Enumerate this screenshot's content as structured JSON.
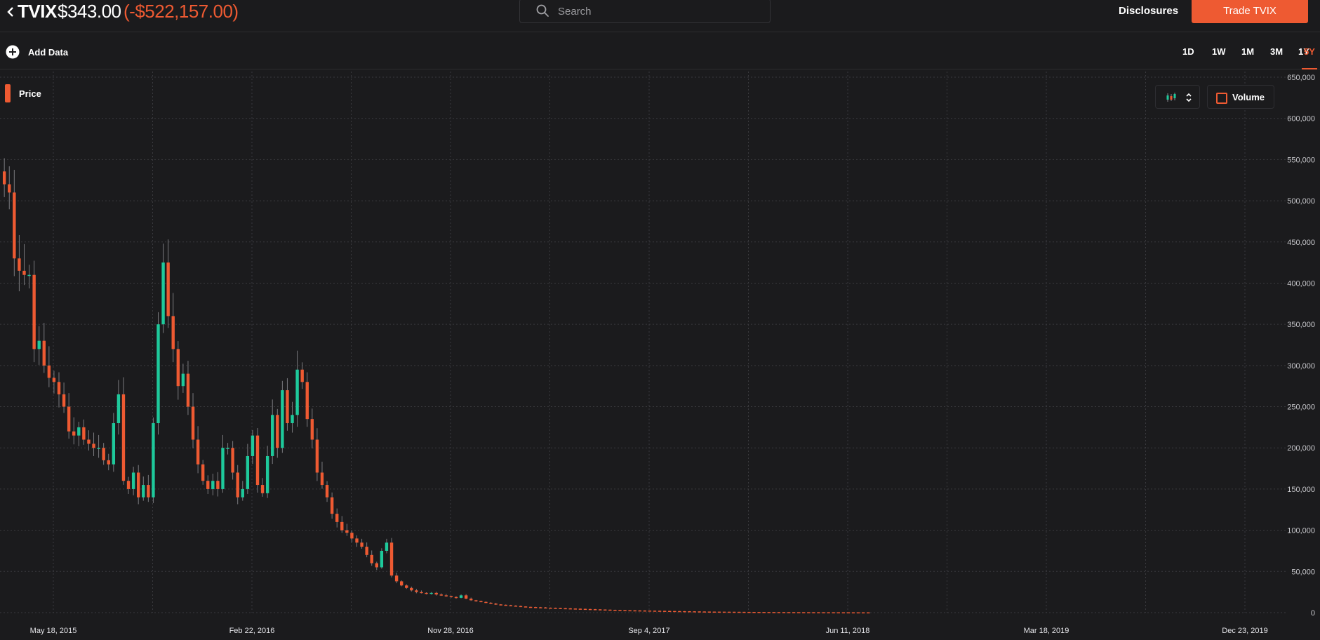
{
  "header": {
    "ticker": "TVIX",
    "price": "$343.00",
    "change": "(-$522,157.00)",
    "disclosures_label": "Disclosures",
    "trade_label": "Trade TVIX"
  },
  "search": {
    "placeholder": "Search",
    "value": ""
  },
  "toolbar": {
    "add_data_label": "Add Data",
    "ranges": [
      "1D",
      "1W",
      "1M",
      "3M",
      "1Y",
      "5Y"
    ],
    "active_range": "5Y"
  },
  "legend": {
    "price_label": "Price",
    "volume_label": "Volume",
    "volume_checked": false
  },
  "colors": {
    "accent": "#ee5a32",
    "up": "#1ec99b",
    "down": "#ee5a32",
    "background": "#1b1b1d",
    "grid": "#3a3a3e"
  },
  "icons": [
    "chevron-left-icon",
    "search-icon",
    "plus-circle-icon",
    "candlestick-icon",
    "sort-arrows-icon"
  ],
  "chart_data": {
    "type": "candlestick",
    "title": "",
    "xlabel": "",
    "ylabel": "",
    "ylim": [
      0,
      650000
    ],
    "y_ticks": [
      "0",
      "50,000",
      "100,000",
      "150,000",
      "200,000",
      "250,000",
      "300,000",
      "350,000",
      "400,000",
      "450,000",
      "500,000",
      "550,000",
      "600,000",
      "650,000"
    ],
    "y_tick_values": [
      0,
      50000,
      100000,
      150000,
      200000,
      250000,
      300000,
      350000,
      400000,
      450000,
      500000,
      550000,
      600000,
      650000
    ],
    "x_ticks": [
      "May 18, 2015",
      "Feb 22, 2016",
      "Nov 28, 2016",
      "Sep 4, 2017",
      "Jun 11, 2018",
      "Mar 18, 2019",
      "Dec 23, 2019"
    ],
    "x_start": "2015-03-02",
    "grid": true,
    "weekly_close": [
      520000,
      510000,
      430000,
      415000,
      410000,
      410000,
      320000,
      330000,
      300000,
      285000,
      280000,
      265000,
      250000,
      220000,
      215000,
      225000,
      210000,
      205000,
      200000,
      200000,
      185000,
      180000,
      230000,
      265000,
      160000,
      150000,
      170000,
      140000,
      155000,
      140000,
      230000,
      350000,
      425000,
      360000,
      320000,
      275000,
      290000,
      250000,
      210000,
      180000,
      160000,
      150000,
      160000,
      150000,
      200000,
      200000,
      170000,
      140000,
      150000,
      190000,
      215000,
      155000,
      145000,
      190000,
      240000,
      200000,
      270000,
      230000,
      240000,
      295000,
      280000,
      235000,
      210000,
      170000,
      155000,
      140000,
      120000,
      110000,
      100000,
      97000,
      90000,
      85000,
      80000,
      70000,
      60000,
      55000,
      75000,
      85000,
      45000,
      38000,
      33000,
      30000,
      27000,
      25000,
      24000,
      23000,
      24000,
      22000,
      21000,
      20000,
      19000,
      18000,
      21000,
      17000,
      15000,
      14000,
      13000,
      12000,
      11000,
      10000,
      9500,
      9000,
      8500,
      8000,
      7500,
      7000,
      6800,
      6500,
      6300,
      6000,
      5800,
      5600,
      5400,
      5200,
      5000,
      4800,
      4600,
      4400,
      4200,
      4000,
      3800,
      3600,
      3400,
      3200,
      3000,
      2900,
      2800,
      2700,
      2600,
      2500,
      2400,
      2300,
      2200,
      2100,
      2000,
      1900,
      1800,
      1700,
      1600,
      1500,
      1400,
      1300,
      1250,
      1200,
      1150,
      1100,
      1050,
      1000,
      950,
      900,
      860,
      820,
      780,
      740,
      700,
      670,
      640,
      610,
      580,
      560,
      540,
      520,
      500,
      480,
      460,
      445,
      430,
      415,
      400,
      390,
      380,
      370,
      360,
      350,
      343
    ]
  }
}
